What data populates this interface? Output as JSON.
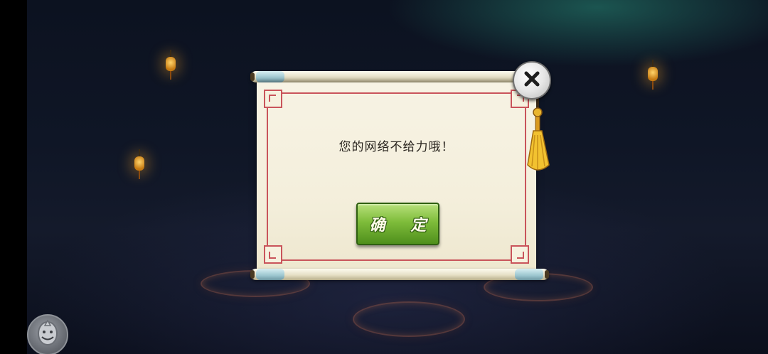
{
  "dialog": {
    "message": "您的网络不给力哦！",
    "confirm_label": "确 定"
  },
  "icons": {
    "close": "close-icon",
    "tassel": "tassel-icon",
    "avatar": "mascot-avatar-icon"
  },
  "colors": {
    "paper": "#f6f1df",
    "border": "#c9545b",
    "confirm_button": "#7ebc3a"
  }
}
